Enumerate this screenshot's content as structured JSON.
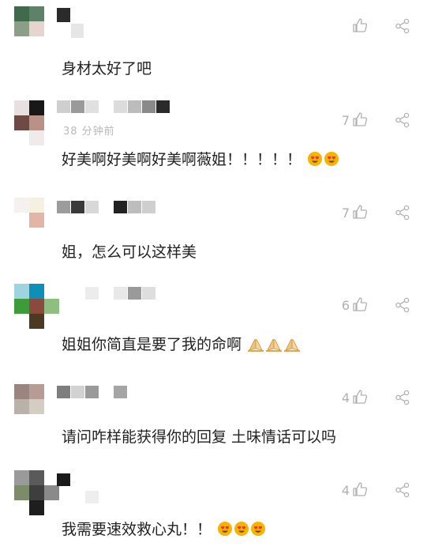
{
  "colors": {
    "text": "#222222",
    "meta": "#b9b9b9",
    "icon": "#b0b0b0"
  },
  "comments": [
    {
      "text": "身材太好了吧",
      "timestamp": "",
      "likes": "",
      "emojis": []
    },
    {
      "text": "好美啊好美啊好美啊薇姐！！！！！",
      "timestamp": "38 分钟前",
      "likes": "7",
      "emojis": [
        "heart-eyes-emoji",
        "heart-eyes-emoji"
      ]
    },
    {
      "text": "姐，怎么可以这样美",
      "timestamp": "",
      "likes": "7",
      "emojis": []
    },
    {
      "text": "姐姐你简直是要了我的命啊",
      "timestamp": "",
      "likes": "6",
      "emojis": [
        "praying-hands-emoji",
        "praying-hands-emoji",
        "praying-hands-emoji"
      ]
    },
    {
      "text": "请问咋样能获得你的回复 土味情话可以吗",
      "timestamp": "",
      "likes": "4",
      "emojis": []
    },
    {
      "text": "我需要速效救心丸！！",
      "timestamp": "",
      "likes": "4",
      "emojis": [
        "heart-eyes-emoji",
        "heart-eyes-emoji",
        "heart-eyes-emoji"
      ]
    }
  ]
}
